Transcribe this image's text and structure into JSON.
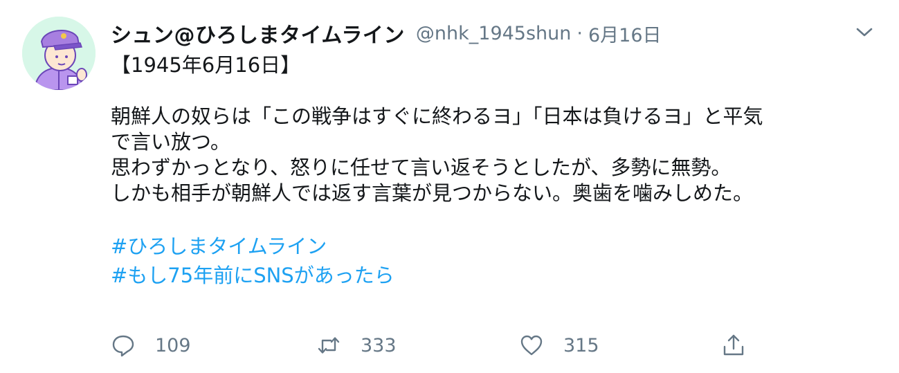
{
  "tweet": {
    "display_name": "シュン@ひろしまタイムライン",
    "handle": "@nhk_1945shun",
    "separator": "·",
    "date": "6月16日",
    "lines": [
      "【1945年6月16日】",
      "",
      "朝鮮人の奴らは「この戦争はすぐに終わるヨ」「日本は負けるヨ」と平気",
      "で言い放つ。",
      "思わずかっとなり、怒りに任せて言い返そうとしたが、多勢に無勢。",
      "しかも相手が朝鮮人では返す言葉が見つからない。奥歯を噛みしめた。",
      ""
    ],
    "hashtags": [
      "#ひろしまタイムライン",
      "#もし75年前にSNSがあったら"
    ]
  },
  "actions": {
    "reply": {
      "icon": "reply-icon",
      "count": "109"
    },
    "retweet": {
      "icon": "retweet-icon",
      "count": "333"
    },
    "like": {
      "icon": "heart-icon",
      "count": "315"
    },
    "share": {
      "icon": "share-icon"
    }
  },
  "colors": {
    "link": "#1da1f2",
    "secondary_text": "#657786",
    "primary_text": "#14171a",
    "avatar_bg": "#d7f7e8",
    "avatar_purple": "#a77fe0"
  }
}
